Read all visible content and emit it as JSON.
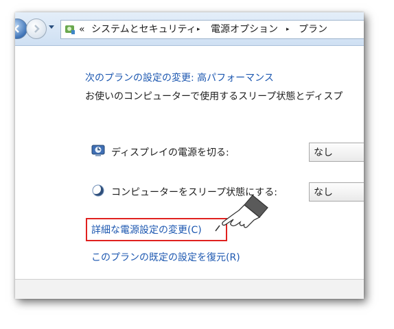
{
  "address_bar": {
    "overflow_chevron": "«",
    "breadcrumbs": [
      "システムとセキュリティ",
      "電源オプション",
      "プラン"
    ],
    "separator": "▸",
    "icons": [
      "back-arrow-icon",
      "forward-arrow-icon",
      "control-panel-icon"
    ]
  },
  "plan": {
    "title": "次のプランの設定の変更: 高パフォーマンス",
    "description": "お使いのコンピューターで使用するスリープ状態とディスプ"
  },
  "settings": [
    {
      "icon": "display-power-icon",
      "label": "ディスプレイの電源を切る:",
      "value": "なし"
    },
    {
      "icon": "sleep-moon-icon",
      "label": "コンピューターをスリープ状態にする:",
      "value": "なし"
    }
  ],
  "links": {
    "advanced": "詳細な電源設定の変更(C)",
    "restore": "このプランの既定の設定を復元(R)"
  },
  "colors": {
    "link": "#1c57b0",
    "highlight": "#e0201e"
  }
}
